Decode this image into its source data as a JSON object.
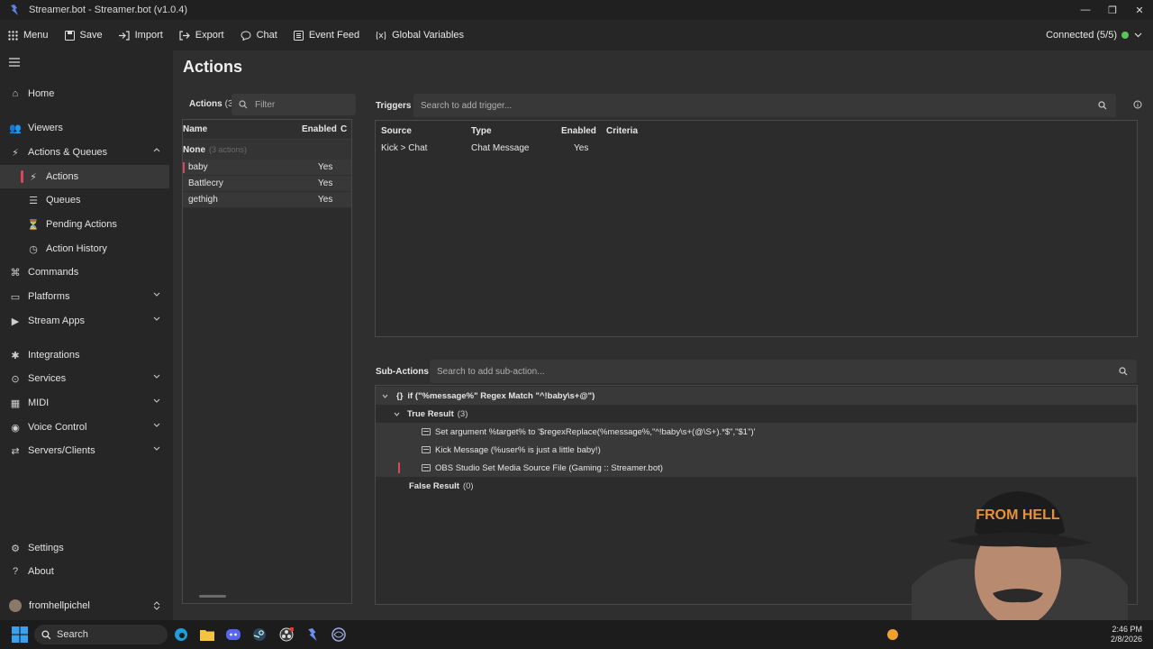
{
  "window": {
    "title": "Streamer.bot - Streamer.bot (v1.0.4)"
  },
  "menubar": {
    "items": [
      "Menu",
      "Save",
      "Import",
      "Export",
      "Chat",
      "Event Feed",
      "Global Variables"
    ],
    "connection": "Connected (5/5)",
    "connection_color": "#5ac35a"
  },
  "sidebar": {
    "items": [
      {
        "label": "Home",
        "icon": "home-icon"
      },
      {
        "label": "Viewers",
        "icon": "viewers-icon"
      },
      {
        "label": "Actions & Queues",
        "icon": "actions-icon"
      },
      {
        "label": "Actions",
        "icon": "actions-icon"
      },
      {
        "label": "Queues",
        "icon": "queues-icon"
      },
      {
        "label": "Pending Actions",
        "icon": "pending-icon"
      },
      {
        "label": "Action History",
        "icon": "history-icon"
      },
      {
        "label": "Commands",
        "icon": "commands-icon"
      },
      {
        "label": "Platforms",
        "icon": "platforms-icon"
      },
      {
        "label": "Stream Apps",
        "icon": "stream-apps-icon"
      },
      {
        "label": "Integrations",
        "icon": "integrations-icon"
      },
      {
        "label": "Services",
        "icon": "services-icon"
      },
      {
        "label": "MIDI",
        "icon": "midi-icon"
      },
      {
        "label": "Voice Control",
        "icon": "voice-icon"
      },
      {
        "label": "Servers/Clients",
        "icon": "servers-icon"
      },
      {
        "label": "Settings",
        "icon": "gear-icon"
      },
      {
        "label": "About",
        "icon": "question-icon"
      }
    ],
    "user": "fromhellpichel"
  },
  "page": {
    "title": "Actions"
  },
  "actions_panel": {
    "heading": "Actions",
    "count": "(3)",
    "filter_placeholder": "Filter",
    "columns": [
      "Name",
      "Enabled",
      "C"
    ],
    "group": "None",
    "group_count": "(3 actions)",
    "rows": [
      {
        "name": "baby",
        "enabled": "Yes"
      },
      {
        "name": "Battlecry",
        "enabled": "Yes"
      },
      {
        "name": "gethigh",
        "enabled": "Yes"
      }
    ]
  },
  "triggers": {
    "heading": "Triggers",
    "placeholder": "Search to add trigger...",
    "columns": [
      "Source",
      "Type",
      "Enabled",
      "Criteria"
    ],
    "rows": [
      {
        "source": "Kick > Chat",
        "type": "Chat Message",
        "enabled": "Yes",
        "criteria": ""
      }
    ]
  },
  "subactions": {
    "heading": "Sub-Actions",
    "placeholder": "Search to add sub-action...",
    "if_text": "if (\"%message%\" Regex Match \"^!baby\\s+@\")",
    "true_label": "True Result",
    "true_count": "(3)",
    "items": [
      "Set argument %target% to '$regexReplace(%message%,\"^!baby\\s+(@\\S+).*$\",\"$1\")'",
      "Kick Message (%user% is just a little baby!)",
      "OBS Studio Set Media Source File (Gaming :: Streamer.bot)"
    ],
    "false_label": "False Result",
    "false_count": "(0)"
  },
  "taskbar": {
    "search": "Search",
    "time": "2:46 PM",
    "date": "2/8/2026"
  }
}
